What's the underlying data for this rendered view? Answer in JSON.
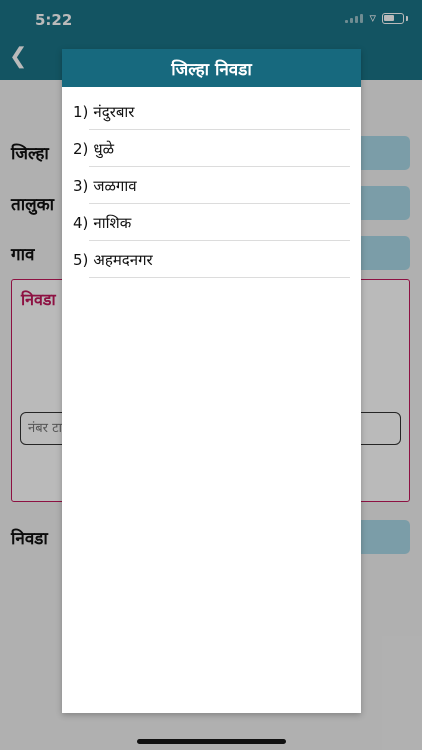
{
  "status_bar": {
    "time": "5:22"
  },
  "form": {
    "district_label": "जिल्हा",
    "taluka_label": "तालुका",
    "village_label": "गाव",
    "panel_title": "निवडा",
    "number_placeholder": "नंबर टाका",
    "select_label": "निवडा"
  },
  "dialog": {
    "title": "जिल्हा निवडा",
    "items": [
      {
        "num": "1)",
        "name": "नंदुरबार"
      },
      {
        "num": "2)",
        "name": "धुळे"
      },
      {
        "num": "3)",
        "name": "जळगाव"
      },
      {
        "num": "4)",
        "name": "नाशिक"
      },
      {
        "num": "5)",
        "name": "अहमदनगर"
      }
    ]
  },
  "colors": {
    "header": "#1b7387",
    "dialog_header": "#17697e",
    "field": "#a9d8e6",
    "panel_border": "#c2185b"
  }
}
